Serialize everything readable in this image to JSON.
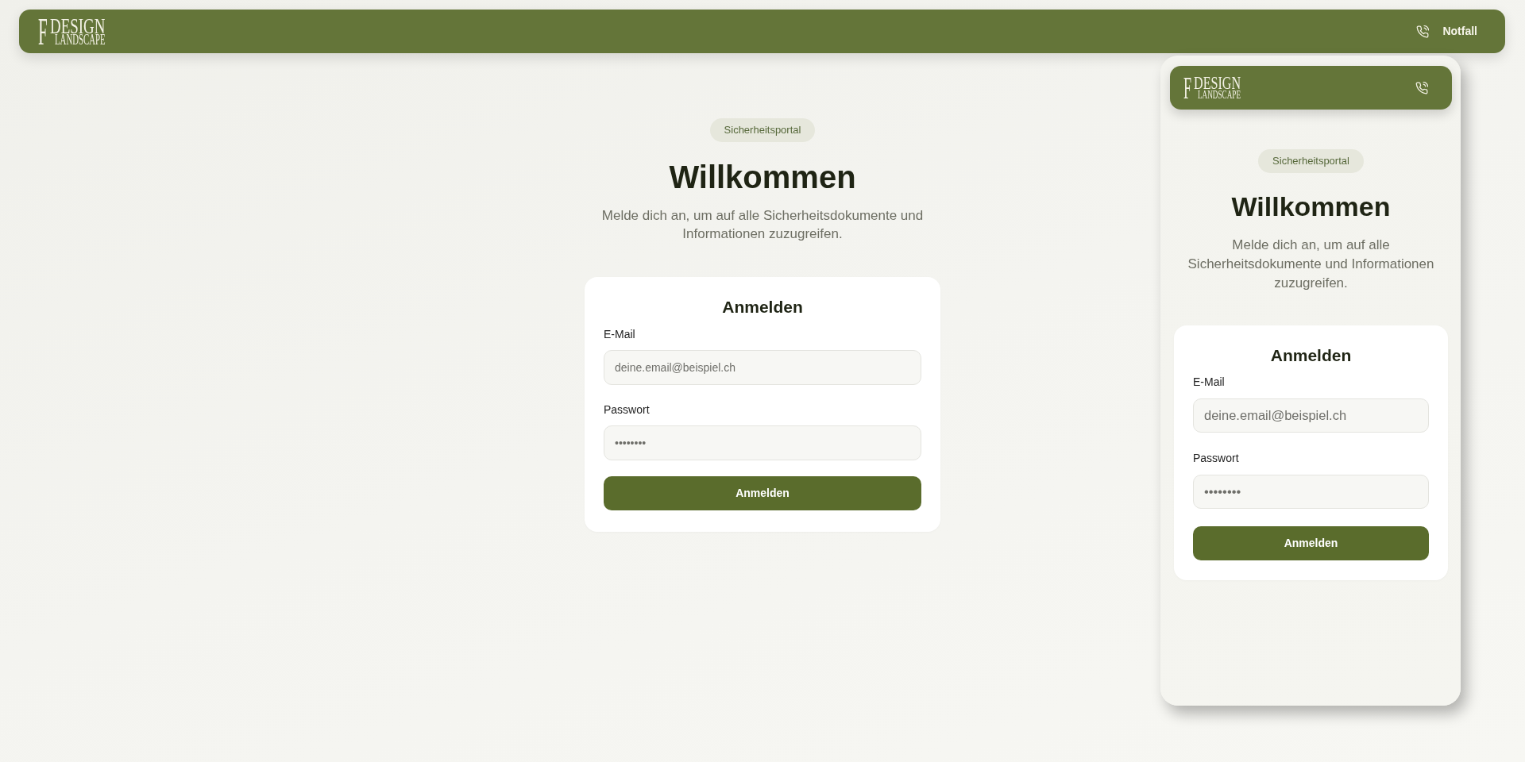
{
  "navbar": {
    "logo": {
      "initial": "F",
      "line_1": "DESIGN",
      "line_2": "LANDSCAPE"
    },
    "emergency_link": {
      "label": "Notfall"
    }
  },
  "hero": {
    "badge": "Sicherheitsportal",
    "title": "Willkommen",
    "subtitle": "Melde dich an, um auf alle Sicherheitsdokumente und Informationen zuzugreifen."
  },
  "login_card": {
    "title": "Anmelden",
    "fields": [
      {
        "label": "E-Mail",
        "placeholder": "deine.email@beispiel.ch"
      },
      {
        "label": "Passwort",
        "placeholder": "••••••••"
      }
    ],
    "submit_button": "Anmelden"
  },
  "mobile_preview": {
    "navbar": {
      "logo": {
        "initial": "F",
        "line_1": "DESIGN",
        "line_2": "LANDSCAPE"
      }
    },
    "hero": {
      "badge": "Sicherheitsportal",
      "title": "Willkommen",
      "subtitle": "Melde dich an, um auf alle Sicherheitsdokumente und Informationen zuzugreifen."
    },
    "login_card": {
      "title": "Anmelden",
      "fields": [
        {
          "label": "E-Mail",
          "placeholder": "deine.email@beispiel.ch"
        },
        {
          "label": "Passwort",
          "placeholder": "••••••••"
        }
      ],
      "submit_button": "Anmelden"
    }
  }
}
